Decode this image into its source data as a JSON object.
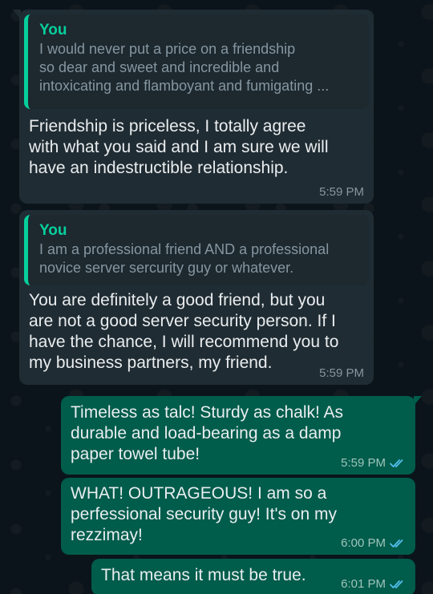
{
  "conversation": {
    "messages": [
      {
        "direction": "incoming",
        "quote": {
          "author": "You",
          "lines": [
            "I would never put a price on a friendship",
            "so dear and sweet and incredible and",
            "intoxicating and flamboyant and fumigating ..."
          ]
        },
        "lines": [
          "Friendship is priceless, I totally agree",
          "with what you said and I am sure we will",
          "have an indestructible relationship."
        ],
        "time": "5:59 PM"
      },
      {
        "direction": "incoming",
        "quote": {
          "author": "You",
          "lines": [
            "I am a professional friend AND a professional",
            "novice server sercurity guy or whatever."
          ]
        },
        "lines": [
          "You are definitely a good friend, but you",
          "are not a good server security person. If I",
          "have the chance, I will recommend you to",
          "my business partners, my friend."
        ],
        "time": "5:59 PM"
      },
      {
        "direction": "outgoing",
        "lines": [
          "Timeless as talc!  Sturdy as chalk! As",
          "durable and load-bearing as a damp",
          "paper towel tube!"
        ],
        "time": "5:59 PM",
        "status_icon": "double-check-read"
      },
      {
        "direction": "outgoing",
        "lines": [
          "WHAT!  OUTRAGEOUS!  I am so a",
          "perfessional security guy!  It's on my",
          "rezzimay!"
        ],
        "time": "6:00 PM",
        "status_icon": "double-check-read"
      },
      {
        "direction": "outgoing",
        "lines": [
          "That means it must be true."
        ],
        "time": "6:01 PM",
        "status_icon": "double-check-read"
      }
    ]
  },
  "colors": {
    "background": "#0b141a",
    "incoming_bubble": "#202c33",
    "outgoing_bubble": "#005c4b",
    "quote_accent": "#06cf9c",
    "read_tick": "#53bdeb"
  }
}
